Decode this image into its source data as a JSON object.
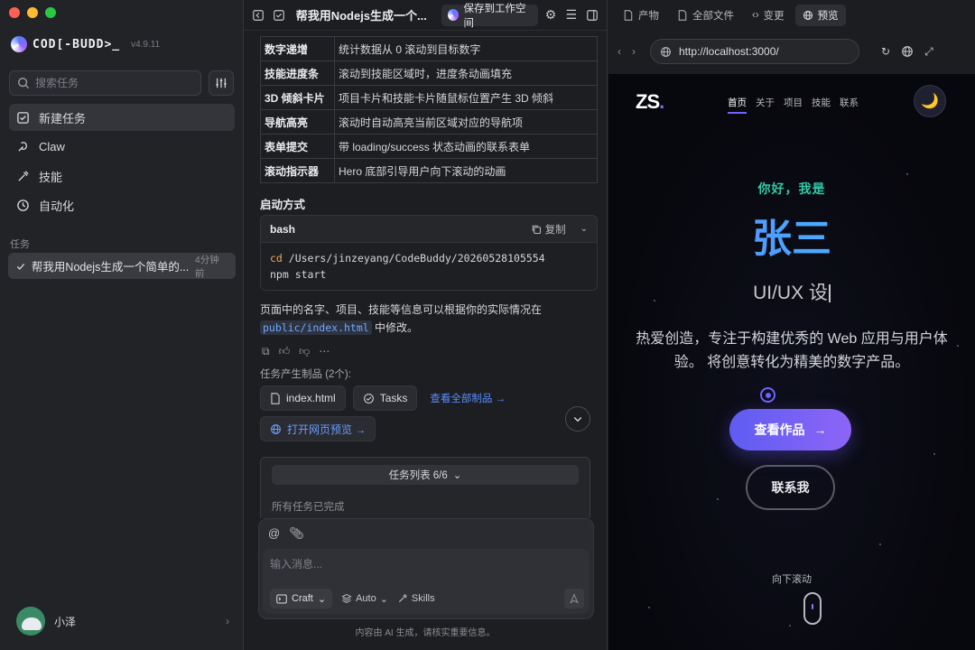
{
  "sidebar": {
    "logo_text": "COD[-BUDD>_",
    "version": "v4.9.11",
    "search_placeholder": "搜索任务",
    "nav": [
      {
        "label": "新建任务"
      },
      {
        "label": "Claw"
      },
      {
        "label": "技能"
      },
      {
        "label": "自动化"
      }
    ],
    "section_label": "任务",
    "task": {
      "title": "帮我用Nodejs生成一个简单的...",
      "time": "4分钟前"
    },
    "user_name": "小泽"
  },
  "middle": {
    "title": "帮我用Nodejs生成一个...",
    "save_label": "保存到工作空间",
    "features": [
      {
        "k": "数字递增",
        "v": "统计数据从 0 滚动到目标数字"
      },
      {
        "k": "技能进度条",
        "v": "滚动到技能区域时，进度条动画填充"
      },
      {
        "k": "3D 倾斜卡片",
        "v": "项目卡片和技能卡片随鼠标位置产生 3D 倾斜"
      },
      {
        "k": "导航高亮",
        "v": "滚动时自动高亮当前区域对应的导航项"
      },
      {
        "k": "表单提交",
        "v": "带 loading/success 状态动画的联系表单"
      },
      {
        "k": "滚动指示器",
        "v": "Hero 底部引导用户向下滚动的动画"
      }
    ],
    "start_title": "启动方式",
    "code": {
      "lang": "bash",
      "copy_label": "复制",
      "line1_kw": "cd",
      "line1_rest": " /Users/jinzeyang/CodeBuddy/20260528105554",
      "line2": "npm start"
    },
    "para_before": "页面中的名字、项目、技能等信息可以根据你的实际情况在",
    "para_code": "public/index.html",
    "para_after": " 中修改。",
    "artifacts_label": "任务产生制品 (2个):",
    "chip_file": "index.html",
    "chip_tasks": "Tasks",
    "view_all": "查看全部制品 →",
    "open_preview": "打开网页预览 →",
    "tasks_header": "任务列表 6/6",
    "tasks_done": "所有任务已完成",
    "composer_placeholder": "输入消息...",
    "mode_label": "Craft",
    "auto_label": "Auto",
    "skills_label": "Skills",
    "disclaimer": "内容由 AI 生成，请核实重要信息。"
  },
  "right": {
    "tabs": [
      {
        "label": "产物"
      },
      {
        "label": "全部文件"
      },
      {
        "label": "变更"
      },
      {
        "label": "预览"
      }
    ],
    "url": "http://localhost:3000/",
    "site": {
      "logo": "ZS",
      "logo_dot": ".",
      "nav": [
        "首页",
        "关于",
        "项目",
        "技能",
        "联系"
      ],
      "hello": "你好，我是",
      "name": "张三",
      "role": "UI/UX 设",
      "intro": "热爱创造，专注于构建优秀的 Web 应用与用户体验。 将创意转化为精美的数字产品。",
      "cta": "查看作品",
      "contact": "联系我",
      "scroll_hint": "向下滚动"
    }
  }
}
